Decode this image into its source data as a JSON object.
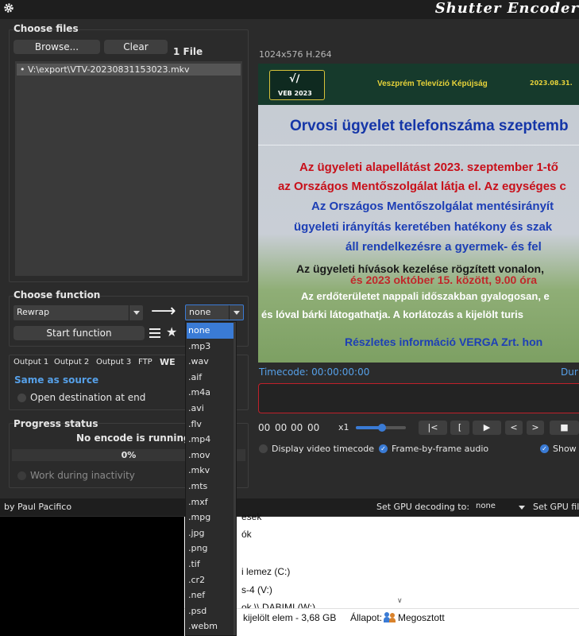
{
  "app": {
    "title": "Shutter Encoder"
  },
  "choose_files": {
    "title": "Choose files",
    "browse_label": "Browse...",
    "clear_label": "Clear",
    "file_count": "1 File",
    "files": [
      "V:\\export\\VTV-20230831153023.mkv"
    ]
  },
  "choose_function": {
    "title": "Choose function",
    "function_value": "Rewrap",
    "arrow_glyph": "⟶",
    "format_value": "none",
    "start_label": "Start function"
  },
  "outputs": {
    "tabs": [
      "Output 1",
      "Output 2",
      "Output 3",
      "FTP",
      "WE"
    ],
    "destination": "Same as source",
    "open_destination_label": "Open destination at end"
  },
  "progress": {
    "title": "Progress status",
    "status": "No encode is running",
    "percent_text": "0%",
    "percent": 0,
    "work_inactivity_label": "Work during inactivity"
  },
  "preview": {
    "resolution": "1024x576 H.264",
    "timecode_label": "Timecode: 00:00:00:00",
    "duration_label": "Dur",
    "tc_fields": [
      "00",
      "00",
      "00",
      "00"
    ],
    "speed": "x1",
    "controls": [
      "|<",
      "[",
      "▶",
      "<",
      ">",
      "■"
    ],
    "display_timecode_label": "Display video timecode",
    "frame_audio_label": "Frame-by-frame audio",
    "show_label": "Show"
  },
  "video_frame": {
    "logo_text": "VEB 2023",
    "channel_name": "Veszprém Televízió Képújság",
    "date": "2023.08.31.",
    "headline": "Orvosi ügyelet telefonszáma szeptemb",
    "lines": [
      "Az ügyeleti alapellátást 2023. szeptember 1-tő",
      "az Országos Mentőszolgálat látja el. Az egységes c",
      "Az Országos Mentőszolgálat mentésirányít",
      "ügyeleti irányítás keretében hatékony és szak",
      "áll rendelkezésre a gyermek- és fel",
      "Az ügyeleti hívások kezelése rögzített vonalon,",
      "Az erdőterületet nappali időszakban gyalogosan, e",
      "és lóval bárki látogathatja. A korlátozás a kijelölt turis",
      "Részletes információ VERGA Zrt. hon"
    ],
    "overlay_line": "és 2023 október 15. között, 9.00 óra",
    "colors": {
      "headline": "#1536a8",
      "red_text": "#c8101a",
      "blue_text": "#1d3fb5",
      "dark_text": "#1a1a1a",
      "white_text": "#ffffff"
    }
  },
  "statusbar": {
    "author": "by Paul Pacifico",
    "gpu_decoding_label": "Set GPU decoding to:",
    "gpu_decoding_value": "none",
    "gpu_filter_label": "Set GPU fil"
  },
  "explorer": {
    "items": [
      "esek",
      "ók",
      "i lemez (C:)",
      "s-4 (V:)",
      "ok \\\\ DABIMI (W:)"
    ],
    "selected_info": "kijelölt elem - 3,68 GB",
    "state_label": "Állapot:",
    "state_value": "Megosztott"
  },
  "dropdown": {
    "options": [
      "none",
      ".mp3",
      ".wav",
      ".aif",
      ".m4a",
      ".avi",
      ".flv",
      ".mp4",
      ".mov",
      ".mkv",
      ".mts",
      ".mxf",
      ".mpg",
      ".jpg",
      ".png",
      ".tif",
      ".cr2",
      ".nef",
      ".psd",
      ".webm"
    ],
    "selected": "none"
  },
  "theme": {
    "accent": "#3a7bd5",
    "bg": "#2b2b2b",
    "timeline_border": "#c0202a"
  }
}
